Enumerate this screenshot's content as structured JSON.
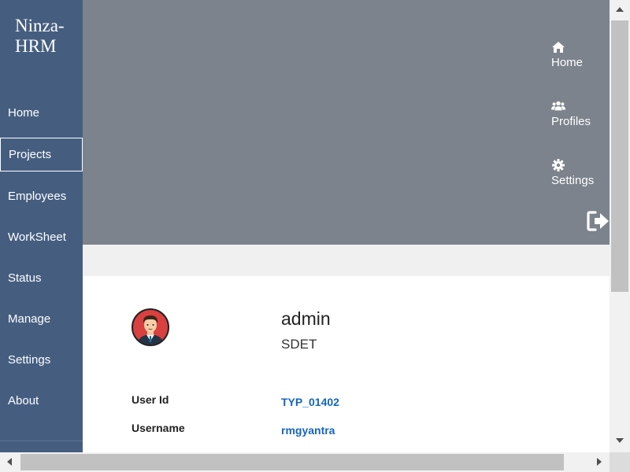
{
  "brand": {
    "title": "Ninza-HRM"
  },
  "sidebar": {
    "items": [
      {
        "label": "Home"
      },
      {
        "label": "Projects",
        "active": true
      },
      {
        "label": "Employees"
      },
      {
        "label": "WorkSheet"
      },
      {
        "label": "Status"
      },
      {
        "label": "Manage"
      },
      {
        "label": "Settings"
      },
      {
        "label": "About"
      }
    ]
  },
  "header": {
    "links": [
      {
        "label": "Home",
        "icon": "home-icon"
      },
      {
        "label": "Profiles",
        "icon": "users-icon"
      },
      {
        "label": "Settings",
        "icon": "gear-icon"
      }
    ],
    "logout_icon": "sign-out-icon"
  },
  "profile": {
    "name": "admin",
    "role": "SDET",
    "fields": [
      {
        "label": "User Id",
        "value": "TYP_01402"
      },
      {
        "label": "Username",
        "value": "rmgyantra"
      }
    ]
  },
  "colors": {
    "sidebar": "#455e80",
    "header": "#7c838c",
    "link_value": "#1565c0"
  }
}
